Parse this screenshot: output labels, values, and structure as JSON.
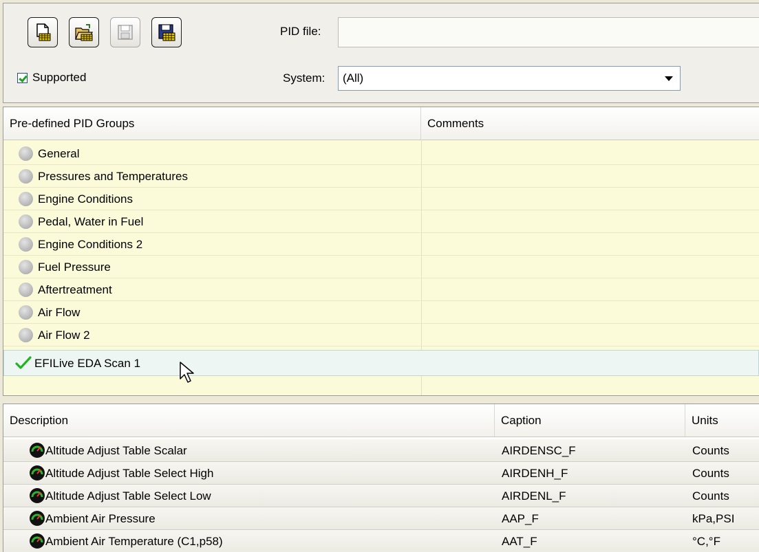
{
  "toolbar": {
    "buttons": [
      {
        "icon": "new-file-icon",
        "enabled": true
      },
      {
        "icon": "open-folder-icon",
        "enabled": true
      },
      {
        "icon": "save-disk-icon",
        "enabled": false
      },
      {
        "icon": "save-as-disk-icon",
        "enabled": true
      }
    ],
    "supported_label": "Supported",
    "supported_checked": true,
    "pid_file_label": "PID file:",
    "pid_file_value": "",
    "system_label": "System:",
    "system_value": "(All)"
  },
  "groups": {
    "columns": [
      "Pre-defined PID Groups",
      "Comments"
    ],
    "rows": [
      {
        "name": "General",
        "comment": "",
        "checked": false
      },
      {
        "name": "Pressures and Temperatures",
        "comment": "",
        "checked": false
      },
      {
        "name": "Engine Conditions",
        "comment": "",
        "checked": false
      },
      {
        "name": "Pedal, Water in Fuel",
        "comment": "",
        "checked": false
      },
      {
        "name": "Engine Conditions 2",
        "comment": "",
        "checked": false
      },
      {
        "name": "Fuel Pressure",
        "comment": "",
        "checked": false
      },
      {
        "name": "Aftertreatment",
        "comment": "",
        "checked": false
      },
      {
        "name": "Air Flow",
        "comment": "",
        "checked": false
      },
      {
        "name": "Air Flow 2",
        "comment": "",
        "checked": false
      },
      {
        "name": "EFILive EDA Scan 1",
        "comment": "",
        "checked": true
      }
    ],
    "colors": {
      "row_bg": "#fcfbd9",
      "selected_bg": "#eef6f4",
      "check": "#21b421"
    }
  },
  "pids": {
    "columns": [
      "Description",
      "Caption",
      "Units"
    ],
    "rows": [
      {
        "description": "Altitude Adjust Table Scalar",
        "caption": "AIRDENSC_F",
        "units": "Counts"
      },
      {
        "description": "Altitude Adjust Table Select High",
        "caption": "AIRDENH_F",
        "units": "Counts"
      },
      {
        "description": "Altitude Adjust Table Select Low",
        "caption": "AIRDENL_F",
        "units": "Counts"
      },
      {
        "description": "Ambient Air Pressure",
        "caption": "AAP_F",
        "units": "kPa,PSI"
      },
      {
        "description": "Ambient Air Temperature (C1,p58)",
        "caption": "AAT_F",
        "units": "°C,°F"
      }
    ]
  }
}
